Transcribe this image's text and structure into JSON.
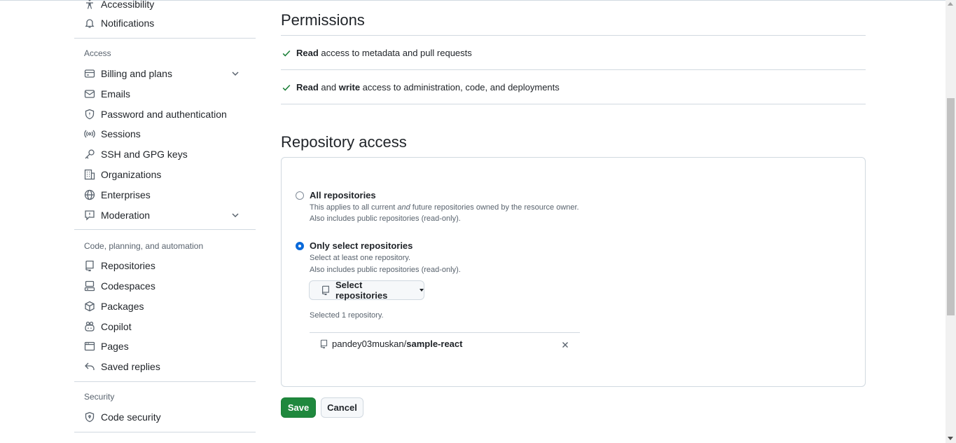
{
  "sidebar": {
    "items_top": [
      {
        "label": "Accessibility",
        "icon": "accessibility-icon"
      },
      {
        "label": "Notifications",
        "icon": "bell-icon"
      }
    ],
    "access_heading": "Access",
    "access_items": [
      {
        "label": "Billing and plans",
        "icon": "credit-card-icon"
      },
      {
        "label": "Emails",
        "icon": "mail-icon"
      },
      {
        "label": "Password and authentication",
        "icon": "shield-icon"
      },
      {
        "label": "Sessions",
        "icon": "broadcast-icon"
      },
      {
        "label": "SSH and GPG keys",
        "icon": "key-icon"
      },
      {
        "label": "Organizations",
        "icon": "organization-icon"
      },
      {
        "label": "Enterprises",
        "icon": "globe-icon"
      },
      {
        "label": "Moderation",
        "icon": "report-icon"
      }
    ],
    "code_heading": "Code, planning, and automation",
    "code_items": [
      {
        "label": "Repositories",
        "icon": "repo-icon"
      },
      {
        "label": "Codespaces",
        "icon": "codespaces-icon"
      },
      {
        "label": "Packages",
        "icon": "package-icon"
      },
      {
        "label": "Copilot",
        "icon": "copilot-icon"
      },
      {
        "label": "Pages",
        "icon": "browser-icon"
      },
      {
        "label": "Saved replies",
        "icon": "reply-icon"
      }
    ],
    "security_heading": "Security",
    "security_items": [
      {
        "label": "Code security",
        "icon": "shield-lock-icon"
      }
    ]
  },
  "permissions": {
    "title": "Permissions",
    "items": [
      {
        "strong1": "Read",
        "mid": "",
        "strong2": "",
        "rest": " access to metadata and pull requests"
      },
      {
        "strong1": "Read",
        "mid": " and ",
        "strong2": "write",
        "rest": " access to administration, code, and deployments"
      }
    ]
  },
  "repository_access": {
    "title": "Repository access",
    "all": {
      "label": "All repositories",
      "note1_a": "This applies to all current ",
      "note1_em": "and",
      "note1_b": " future repositories owned by the resource owner.",
      "note2": "Also includes public repositories (read-only).",
      "selected": false
    },
    "only": {
      "label": "Only select repositories",
      "note1": "Select at least one repository.",
      "note2": "Also includes public repositories (read-only).",
      "selected": true
    },
    "select_button": "Select repositories",
    "selected_count": "Selected 1 repository.",
    "repo_owner": "pandey03muskan/",
    "repo_name": "sample-react"
  },
  "actions": {
    "save": "Save",
    "cancel": "Cancel"
  },
  "colors": {
    "accent": "#0969da",
    "success": "#1f883d",
    "check": "#1a7f37"
  }
}
